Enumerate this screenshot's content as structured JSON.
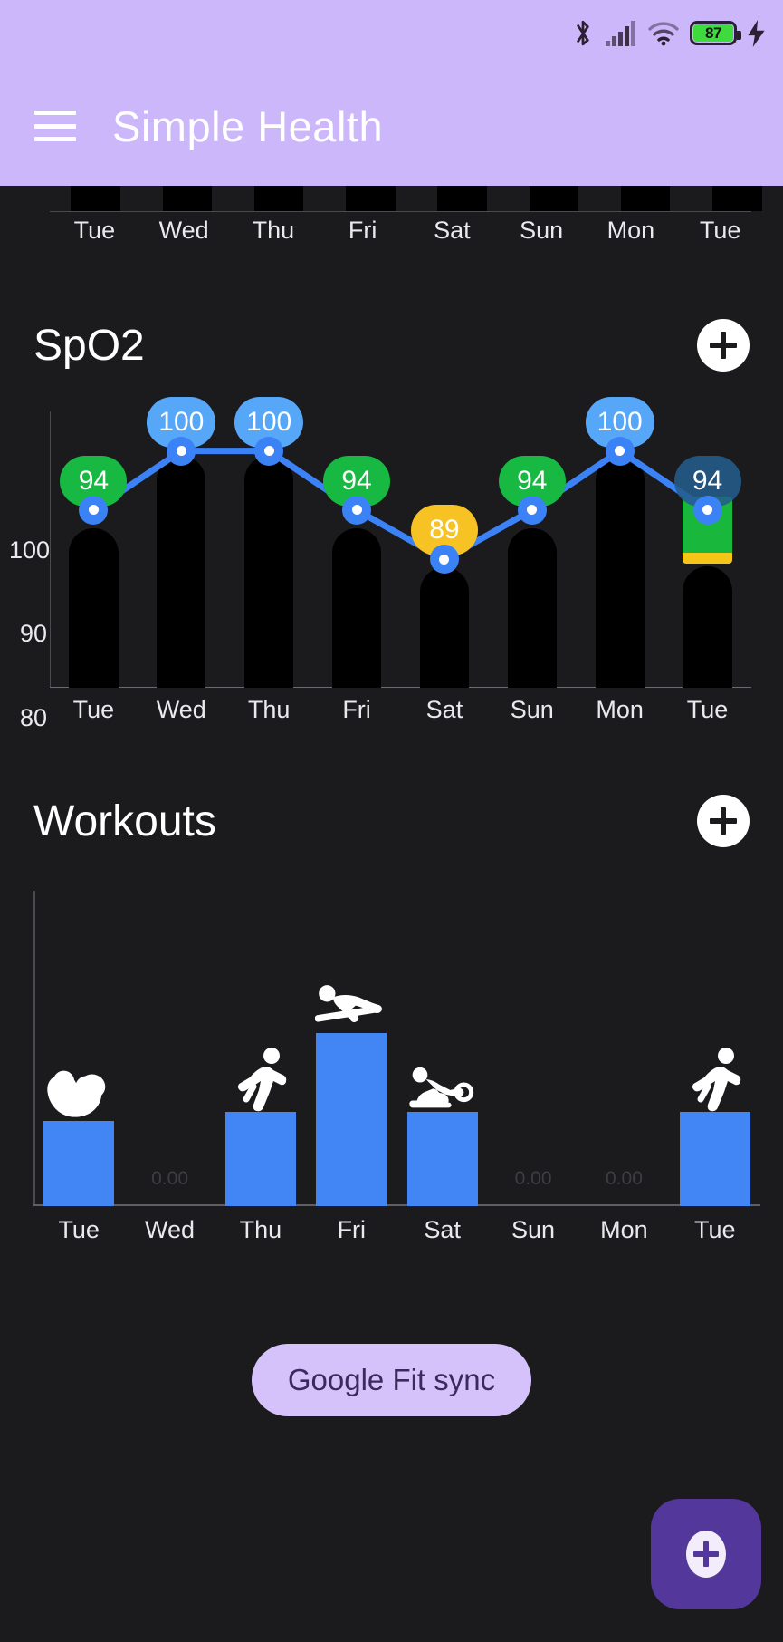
{
  "statusbar": {
    "battery_percent": "87",
    "battery_color": "#3ddb3d",
    "icons": [
      "bluetooth-icon",
      "cellular-signal-icon",
      "wifi-icon",
      "battery-icon",
      "charging-bolt-icon"
    ]
  },
  "appbar": {
    "title": "Simple Health",
    "menu_label": "menu",
    "bg_color": "#cdb7fb",
    "title_color": "#ffffff"
  },
  "top_partial_chart": {
    "day_labels": [
      "Tue",
      "Wed",
      "Thu",
      "Fri",
      "Sat",
      "Sun",
      "Mon",
      "Tue"
    ]
  },
  "spo2": {
    "title": "SpO2",
    "add_label": "add",
    "chart_data": {
      "type": "line",
      "title": "SpO2",
      "xlabel": "",
      "ylabel": "",
      "categories": [
        "Tue",
        "Wed",
        "Thu",
        "Fri",
        "Sat",
        "Sun",
        "Mon",
        "Tue"
      ],
      "values": [
        94,
        100,
        100,
        94,
        89,
        94,
        100,
        94
      ],
      "point_labels": [
        "94",
        "100",
        "100",
        "94",
        "89",
        "94",
        "100",
        "94"
      ],
      "point_colors": [
        "#18b942",
        "#56a7f7",
        "#56a7f7",
        "#18b942",
        "#f7c324",
        "#18b942",
        "#56a7f7",
        "#245c8c"
      ],
      "line_color": "#3b82f6",
      "bar_color": "#000000",
      "highlight_bar_color": "#19b83c",
      "highlight_bar_base_color": "#f5c518",
      "yticks": [
        "100",
        "90",
        "80"
      ],
      "ylim": [
        76,
        104
      ],
      "grid": false,
      "legend": "none"
    }
  },
  "workouts": {
    "title": "Workouts",
    "add_label": "add",
    "chart_data": {
      "type": "bar",
      "title": "Workouts",
      "xlabel": "",
      "ylabel": "",
      "categories": [
        "Tue",
        "Wed",
        "Thu",
        "Fri",
        "Sat",
        "Sun",
        "Mon",
        "Tue"
      ],
      "values": [
        0.27,
        0,
        0.3,
        0.55,
        0.3,
        0,
        0,
        0.3
      ],
      "zero_labels": [
        "",
        "0.00",
        "",
        "",
        "",
        "0.00",
        "0.00",
        ""
      ],
      "icons": [
        "bicep-curl-icon",
        "",
        "running-icon",
        "pilates-icon",
        "rowing-icon",
        "",
        "",
        "running-icon"
      ],
      "bar_color": "#4285f4",
      "ylim": [
        0,
        1
      ],
      "grid": false,
      "legend": "none"
    }
  },
  "bottom": {
    "sync_label": "Google Fit sync",
    "sync_bg": "#d6c2fb",
    "sync_text_color": "#3b2a5c",
    "fab_label": "add",
    "fab_color": "#53379b"
  }
}
